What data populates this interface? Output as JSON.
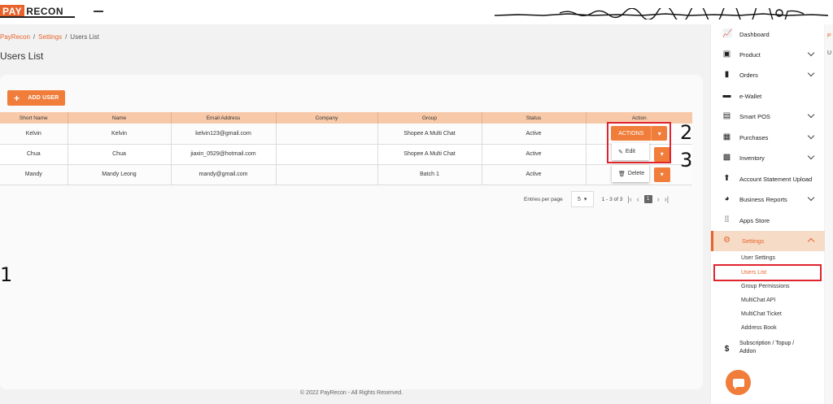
{
  "brand": {
    "pay": "PAY",
    "recon": "RECON",
    "primary_color": "#e8632b",
    "button_color": "#f07d3a"
  },
  "breadcrumb": [
    "PayRecon",
    "/",
    "Settings",
    "/",
    "Users List"
  ],
  "page_title": "Users List",
  "add_user_label": "ADD USER",
  "table": {
    "headers": [
      "Short Name",
      "Name",
      "Email Address",
      "Company",
      "Group",
      "Status",
      "Action"
    ],
    "rows": [
      {
        "short_name": "Kelvin",
        "name": "Kelvin",
        "email": "kelvin123@gmail.com",
        "company": "",
        "group": "Shopee A Multi Chat",
        "status": "Active"
      },
      {
        "short_name": "Chua",
        "name": "Chua",
        "email": "jiaxin_0529@hotmail.com",
        "company": "",
        "group": "Shopee A Multi Chat",
        "status": "Active"
      },
      {
        "short_name": "Mandy",
        "name": "Mandy Leong",
        "email": "mandy@gmail.com",
        "company": "",
        "group": "Batch 1",
        "status": "Active"
      }
    ],
    "actions_label": "ACTIONS"
  },
  "action_menu": {
    "edit": "Edit",
    "delete": "Delete"
  },
  "pagination": {
    "entries_label": "Entries per page",
    "per_page": "5",
    "range": "1 - 3 of 3",
    "current_page": "1"
  },
  "footer": "© 2022 PayRecon - All Rights Reserved.",
  "annotations": {
    "a1": "1",
    "a2": "2",
    "a3": "3"
  },
  "sidebar": {
    "items": [
      {
        "label": "Dashboard",
        "icon": "chart-line-icon"
      },
      {
        "label": "Product",
        "icon": "box-icon"
      },
      {
        "label": "Orders",
        "icon": "clipboard-icon"
      },
      {
        "label": "e-Wallet",
        "icon": "wallet-icon"
      },
      {
        "label": "Smart POS",
        "icon": "cash-register-icon"
      },
      {
        "label": "Purchases",
        "icon": "truck-icon"
      },
      {
        "label": "Inventory",
        "icon": "boxes-icon"
      },
      {
        "label": "Account Statement Upload",
        "icon": "upload-icon"
      },
      {
        "label": "Business Reports",
        "icon": "pie-chart-icon"
      },
      {
        "label": "Apps Store",
        "icon": "grid-icon"
      },
      {
        "label": "Settings",
        "icon": "gear-icon"
      }
    ],
    "settings_sub": [
      "User Settings",
      "Users List",
      "Group Permissions",
      "MultiChat API",
      "MultiChat Ticket",
      "Address Book"
    ],
    "subscription_line1": "Subscription / Topup /",
    "subscription_line2": "Addon"
  },
  "right_strip": {
    "a": "P",
    "b": "U"
  }
}
